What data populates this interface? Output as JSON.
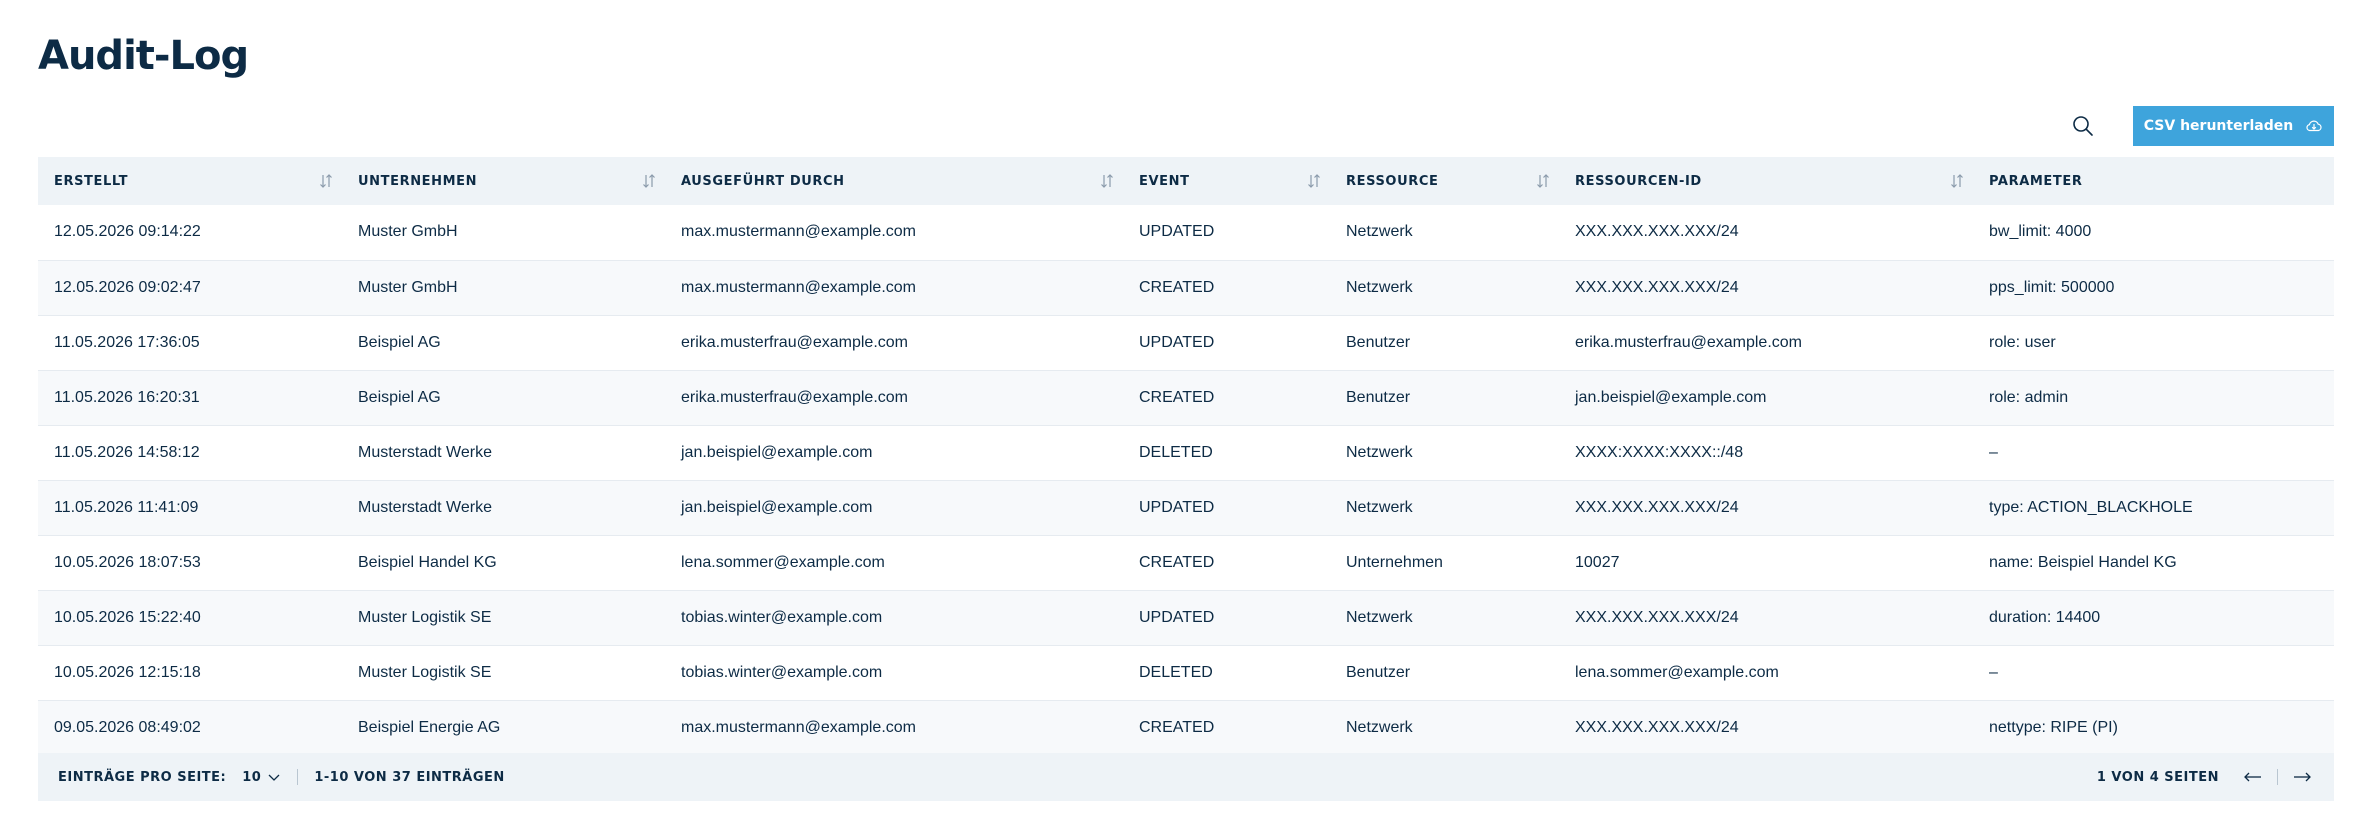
{
  "page": {
    "title": "Audit-Log"
  },
  "toolbar": {
    "csv_label": "CSV herunterladen"
  },
  "table": {
    "columns": [
      "ERSTELLT",
      "UNTERNEHMEN",
      "AUSGEFÜHRT DURCH",
      "EVENT",
      "RESSOURCE",
      "RESSOURCEN-ID",
      "PARAMETER"
    ],
    "rows": [
      [
        "12.05.2026 09:14:22",
        "Muster GmbH",
        "max.mustermann@example.com",
        "UPDATED",
        "Netzwerk",
        "XXX.XXX.XXX.XXX/24",
        "bw_limit: 4000"
      ],
      [
        "12.05.2026 09:02:47",
        "Muster GmbH",
        "max.mustermann@example.com",
        "CREATED",
        "Netzwerk",
        "XXX.XXX.XXX.XXX/24",
        "pps_limit: 500000"
      ],
      [
        "11.05.2026 17:36:05",
        "Beispiel AG",
        "erika.musterfrau@example.com",
        "UPDATED",
        "Benutzer",
        "erika.musterfrau@example.com",
        "role: user"
      ],
      [
        "11.05.2026 16:20:31",
        "Beispiel AG",
        "erika.musterfrau@example.com",
        "CREATED",
        "Benutzer",
        "jan.beispiel@example.com",
        "role: admin"
      ],
      [
        "11.05.2026 14:58:12",
        "Musterstadt Werke",
        "jan.beispiel@example.com",
        "DELETED",
        "Netzwerk",
        "XXXX:XXXX:XXXX::/48",
        "–"
      ],
      [
        "11.05.2026 11:41:09",
        "Musterstadt Werke",
        "jan.beispiel@example.com",
        "UPDATED",
        "Netzwerk",
        "XXX.XXX.XXX.XXX/24",
        "type: ACTION_BLACKHOLE"
      ],
      [
        "10.05.2026 18:07:53",
        "Beispiel Handel KG",
        "lena.sommer@example.com",
        "CREATED",
        "Unternehmen",
        "10027",
        "name: Beispiel Handel KG"
      ],
      [
        "10.05.2026 15:22:40",
        "Muster Logistik SE",
        "tobias.winter@example.com",
        "UPDATED",
        "Netzwerk",
        "XXX.XXX.XXX.XXX/24",
        "duration: 14400"
      ],
      [
        "10.05.2026 12:15:18",
        "Muster Logistik SE",
        "tobias.winter@example.com",
        "DELETED",
        "Benutzer",
        "lena.sommer@example.com",
        "–"
      ],
      [
        "09.05.2026 08:49:02",
        "Beispiel Energie AG",
        "max.mustermann@example.com",
        "CREATED",
        "Netzwerk",
        "XXX.XXX.XXX.XXX/24",
        "nettype: RIPE (PI)"
      ]
    ]
  },
  "pagination": {
    "per_page_label": "EINTRÄGE PRO SEITE:",
    "per_page_value": "10",
    "range_label": "1-10 VON 37 EINTRÄGEN",
    "pages_label": "1 VON 4 SEITEN"
  },
  "icons": {
    "search": "search-icon",
    "cloud_download": "cloud-download-icon",
    "sort": "sort-icon",
    "chevron": "chevron-down-icon",
    "prev": "arrow-left-icon",
    "next": "arrow-right-icon"
  },
  "colors": {
    "primary_text": "#0d2b45",
    "accent": "#3ea4dc",
    "header_bg": "#eef3f7",
    "stripe_bg": "#f7f9fb"
  }
}
